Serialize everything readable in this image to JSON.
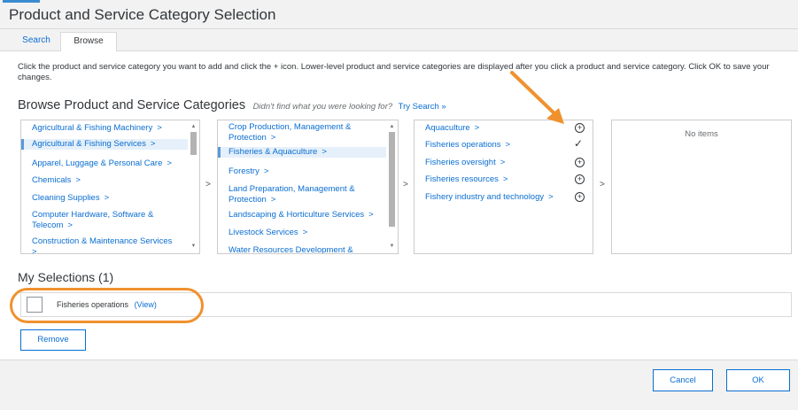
{
  "dialog": {
    "title": "Product and Service Category Selection"
  },
  "tabs": [
    {
      "label": "Search",
      "active": false
    },
    {
      "label": "Browse",
      "active": true
    }
  ],
  "instructions": "Click the product and service category you want to add and click the + icon. Lower-level product and service categories are displayed after you click a product and service category. Click OK to save your changes.",
  "browse": {
    "heading": "Browse Product and Service Categories",
    "hint": "Didn't find what you were looking for?",
    "search_link": "Try Search »",
    "column1": [
      {
        "label": "Agricultural & Fishing Machinery",
        "chevron": ">"
      },
      {
        "label": "Agricultural & Fishing Services",
        "chevron": ">",
        "selected": true
      },
      {
        "label": "Apparel, Luggage & Personal Care",
        "chevron": ">"
      },
      {
        "label": "Chemicals",
        "chevron": ">"
      },
      {
        "label": "Cleaning Supplies",
        "chevron": ">"
      },
      {
        "label": "Computer Hardware, Software & Telecom",
        "chevron": ">"
      },
      {
        "label": "Construction & Maintenance Services",
        "chevron": ">"
      }
    ],
    "column2": [
      {
        "label": "Crop Production, Management & Protection",
        "chevron": ">"
      },
      {
        "label": "Fisheries & Aquaculture",
        "chevron": ">",
        "selected": true
      },
      {
        "label": "Forestry",
        "chevron": ">"
      },
      {
        "label": "Land Preparation, Management & Protection",
        "chevron": ">"
      },
      {
        "label": "Landscaping & Horticulture Services",
        "chevron": ">"
      },
      {
        "label": "Livestock Services",
        "chevron": ">"
      },
      {
        "label": "Water Resources Development &",
        "chevron": ""
      }
    ],
    "column3": [
      {
        "label": "Aquaculture",
        "chevron": ">",
        "action": "add"
      },
      {
        "label": "Fisheries operations",
        "chevron": ">",
        "action": "added"
      },
      {
        "label": "Fisheries oversight",
        "chevron": ">",
        "action": "add"
      },
      {
        "label": "Fisheries resources",
        "chevron": ">",
        "action": "add"
      },
      {
        "label": "Fishery industry and technology",
        "chevron": ">",
        "action": "add"
      }
    ],
    "column4_empty": "No items",
    "between_chevron": ">",
    "add_symbol": "+",
    "added_symbol": "✓",
    "scroll_up": "▲",
    "scroll_down": "▼"
  },
  "selections": {
    "heading": "My Selections (1)",
    "items": [
      {
        "label": "Fisheries operations",
        "link": "(View)"
      }
    ],
    "remove_label": "Remove"
  },
  "footer": {
    "cancel_label": "Cancel",
    "ok_label": "OK"
  },
  "colors": {
    "link": "#0a6ed1",
    "highlight": "#f0912e",
    "selected_row": "#e5f0fa"
  }
}
